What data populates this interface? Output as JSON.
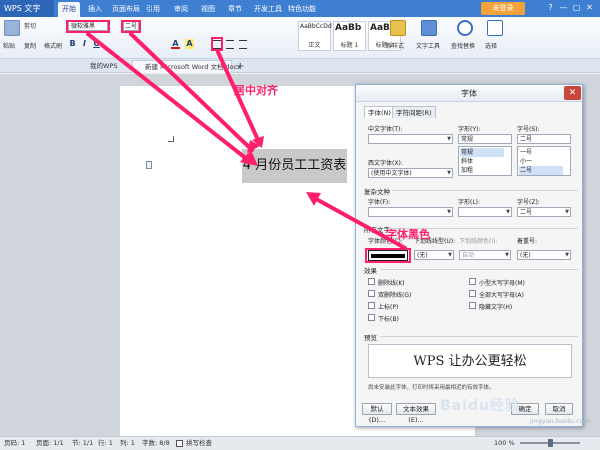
{
  "title_bar": {
    "app_button": "WPS 文字",
    "menu_tabs": [
      "开始",
      "插入",
      "页面布局",
      "引用",
      "审阅",
      "视图",
      "章节",
      "开发工具",
      "特色功能"
    ],
    "login": "未登录",
    "controls": [
      "?",
      "—",
      "▢",
      "✕"
    ]
  },
  "ribbon": {
    "paste": "粘贴",
    "cut": "剪切",
    "copy": "复制",
    "format_painter": "格式刷",
    "font_name": "微软雅黑",
    "font_size": "二号",
    "format_buttons": [
      "B",
      "I",
      "U",
      "A",
      "A"
    ],
    "styles": [
      {
        "sample": "AaBbCcDd",
        "name": "正文"
      },
      {
        "sample": "AaBb",
        "name": "标题 1"
      },
      {
        "sample": "AaBb(",
        "name": "标题 2"
      }
    ],
    "new_style": "新样式",
    "text_tools": "文字工具",
    "find_replace": "查找替换",
    "select": "选择"
  },
  "tabs": {
    "items": [
      "我的WPS",
      "新建 Microsoft Word 文档.docx"
    ],
    "add": "+"
  },
  "document": {
    "title_cell": "4 月份员工工资表"
  },
  "dialog": {
    "title": "字体",
    "tabs": [
      "字体(N)",
      "字符间距(R)"
    ],
    "labels": {
      "chinese_font": "中文字体(T):",
      "style": "字形(Y):",
      "size": "字号(S):",
      "western_font": "西文字体(X):",
      "complex_script": "复杂文种",
      "complex_font": "字体(F):",
      "complex_style": "字形(L):",
      "complex_size": "字号(Z):",
      "all_text": "所有文字",
      "font_color": "字体颜色(C):",
      "underline_type": "下划线线型(U):",
      "underline_color": "下划线颜色(I):",
      "emphasis": "着重号:"
    },
    "values": {
      "chinese_font": "",
      "style": "常规",
      "size": "二号",
      "western_font": "(使用中文字体)",
      "complex_size": "二号",
      "underline_type": "(无)",
      "underline_color": "自动",
      "emphasis": "(无)"
    },
    "style_list": [
      "常规",
      "斜体",
      "加粗"
    ],
    "size_list": [
      "一号",
      "小一",
      "二号"
    ],
    "effects_header": "效果",
    "effects_left": [
      "删除线(K)",
      "双删除线(G)",
      "上标(P)",
      "下标(B)"
    ],
    "effects_right": [
      "小型大写字母(M)",
      "全部大写字母(A)",
      "隐藏文字(H)"
    ],
    "preview_header": "预览",
    "preview_text": "WPS 让办公更轻松",
    "preview_note": "尚未安装此字体，打印时将采用最相近的有效字体。",
    "buttons": {
      "default": "默认(D)...",
      "text_effects": "文本效果(E)...",
      "ok": "确定",
      "cancel": "取消"
    }
  },
  "annotations": {
    "center_align": "居中对齐",
    "font_black": "字体黑色"
  },
  "status_bar": {
    "items": [
      "页码: 1",
      "页面: 1/1",
      "节: 1/1",
      "行: 1",
      "列: 1",
      "字数: 8/8",
      "拼写检查"
    ],
    "zoom": "100 %"
  },
  "watermark": {
    "main": "Baidu经验",
    "sub": "jingyan.baidu.com"
  },
  "colors": {
    "annotation": "#ff1f6a",
    "title_bar": "#3f7fd2",
    "login": "#f3a33b",
    "close": "#c9463d"
  }
}
